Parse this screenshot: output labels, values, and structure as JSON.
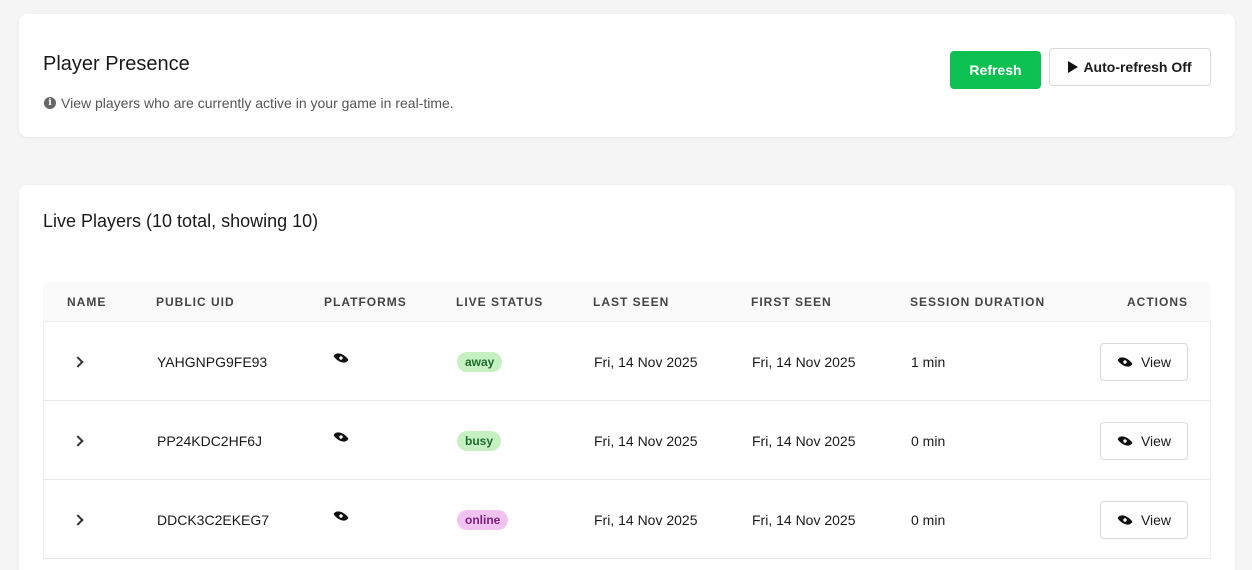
{
  "header": {
    "title": "Player Presence",
    "description": "View players who are currently active in your game in real-time.",
    "refresh_label": "Refresh",
    "auto_refresh_label": "Auto-refresh Off"
  },
  "players_section": {
    "title": "Live Players (10 total, showing 10)",
    "columns": [
      "Name",
      "Public UID",
      "Platforms",
      "Live Status",
      "Last Seen",
      "First Seen",
      "Session Duration",
      "Actions"
    ],
    "rows": [
      {
        "uid": "YAHGNPG9FE93",
        "status": "away",
        "last_seen": "Fri, 14 Nov 2025",
        "first_seen": "Fri, 14 Nov 2025",
        "duration": "1 min",
        "action": "View"
      },
      {
        "uid": "PP24KDC2HF6J",
        "status": "busy",
        "last_seen": "Fri, 14 Nov 2025",
        "first_seen": "Fri, 14 Nov 2025",
        "duration": "0 min",
        "action": "View"
      },
      {
        "uid": "DDCK3C2EKEG7",
        "status": "online",
        "last_seen": "Fri, 14 Nov 2025",
        "first_seen": "Fri, 14 Nov 2025",
        "duration": "0 min",
        "action": "View"
      }
    ]
  },
  "colors": {
    "refresh_button": "#0cc152",
    "status_away_bg": "#c6f0c2",
    "status_away_fg": "#1d6b2a",
    "status_busy_bg": "#c6f0c2",
    "status_busy_fg": "#1d6b2a",
    "status_online_bg": "#f0c3f0",
    "status_online_fg": "#7a1f7a"
  },
  "icons": {
    "info": "info-circle-icon",
    "play": "play-icon",
    "platform": "eye-icon",
    "expand": "chevron-right-icon",
    "view": "eye-icon"
  }
}
